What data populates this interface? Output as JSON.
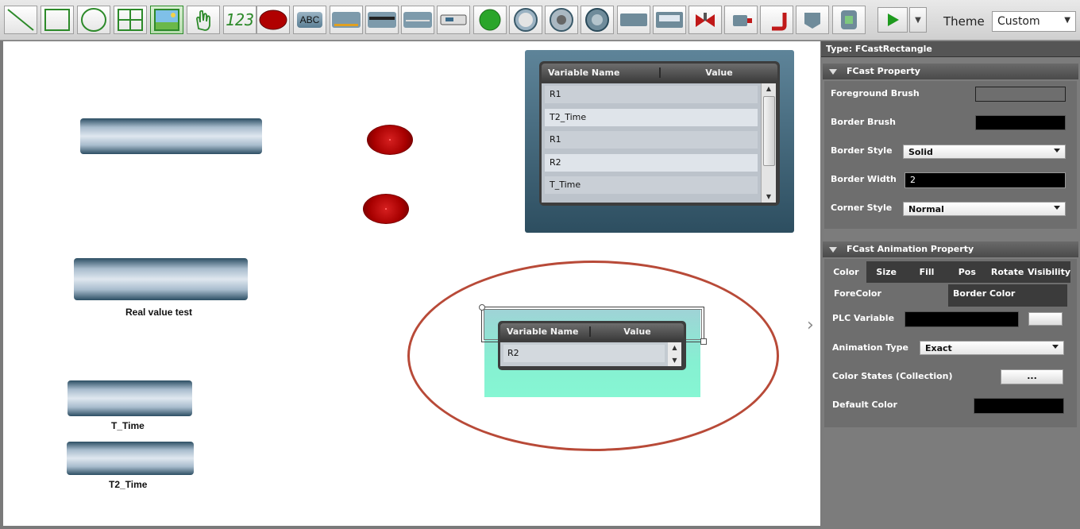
{
  "toolbar": {
    "tools": [
      "line-tool-icon",
      "rectangle-tool-icon",
      "ellipse-tool-icon",
      "grid-tool-icon",
      "image-tool-icon",
      "hand-tool-icon",
      "seven-segment-tool-icon",
      "led-tool-icon",
      "text-label-tool-icon",
      "slider-tool-icon",
      "multi-slider-tool-icon",
      "gauge-bar-tool-icon",
      "chip-tool-icon",
      "green-led-tool-icon",
      "meter-tool-icon",
      "dial-tool-icon",
      "round-gauge-tool-icon",
      "panel-tool-icon",
      "display-tool-icon",
      "valve-tool-icon",
      "motor-tool-icon",
      "pipe-elbow-tool-icon",
      "tank-tool-icon",
      "cylinder-tool-icon"
    ],
    "segment_label": "123",
    "abc_label": "ABC",
    "theme_label": "Theme",
    "theme_value": "Custom"
  },
  "canvas": {
    "labels": {
      "real_value_test": "Real value test",
      "t_time": "T_Time",
      "t2_time": "T2_Time"
    },
    "table": {
      "col_name": "Variable Name",
      "col_value": "Value",
      "rows": [
        "R1",
        "T2_Time",
        "R1",
        "R2",
        "T_Time"
      ]
    },
    "mini_table": {
      "col_name": "Variable Name",
      "col_value": "Value",
      "rows": [
        "R2"
      ]
    }
  },
  "panel": {
    "type": "Type: FCastRectangle",
    "fcast_property": {
      "title": "FCast Property",
      "foreground_brush_label": "Foreground Brush",
      "border_brush_label": "Border Brush",
      "border_style_label": "Border Style",
      "border_style_value": "Solid",
      "border_width_label": "Border Width",
      "border_width_value": "2",
      "corner_style_label": "Corner Style",
      "corner_style_value": "Normal"
    },
    "animation": {
      "title": "FCast Animation Property",
      "tabs": [
        "Color",
        "Size",
        "Fill",
        "Pos",
        "Rotate",
        "Visibility"
      ],
      "forecolor_label": "ForeColor",
      "border_color_label": "Border Color",
      "plc_variable_label": "PLC Variable",
      "animation_type_label": "Animation Type",
      "animation_type_value": "Exact",
      "color_states_label": "Color States (Collection)",
      "color_states_button": "...",
      "default_color_label": "Default Color"
    }
  },
  "colors": {
    "accent_green": "#2d8a2a",
    "led_red": "#c00000",
    "highlight_ellipse": "#b84a38",
    "selection_fill": "#86f0d2"
  }
}
